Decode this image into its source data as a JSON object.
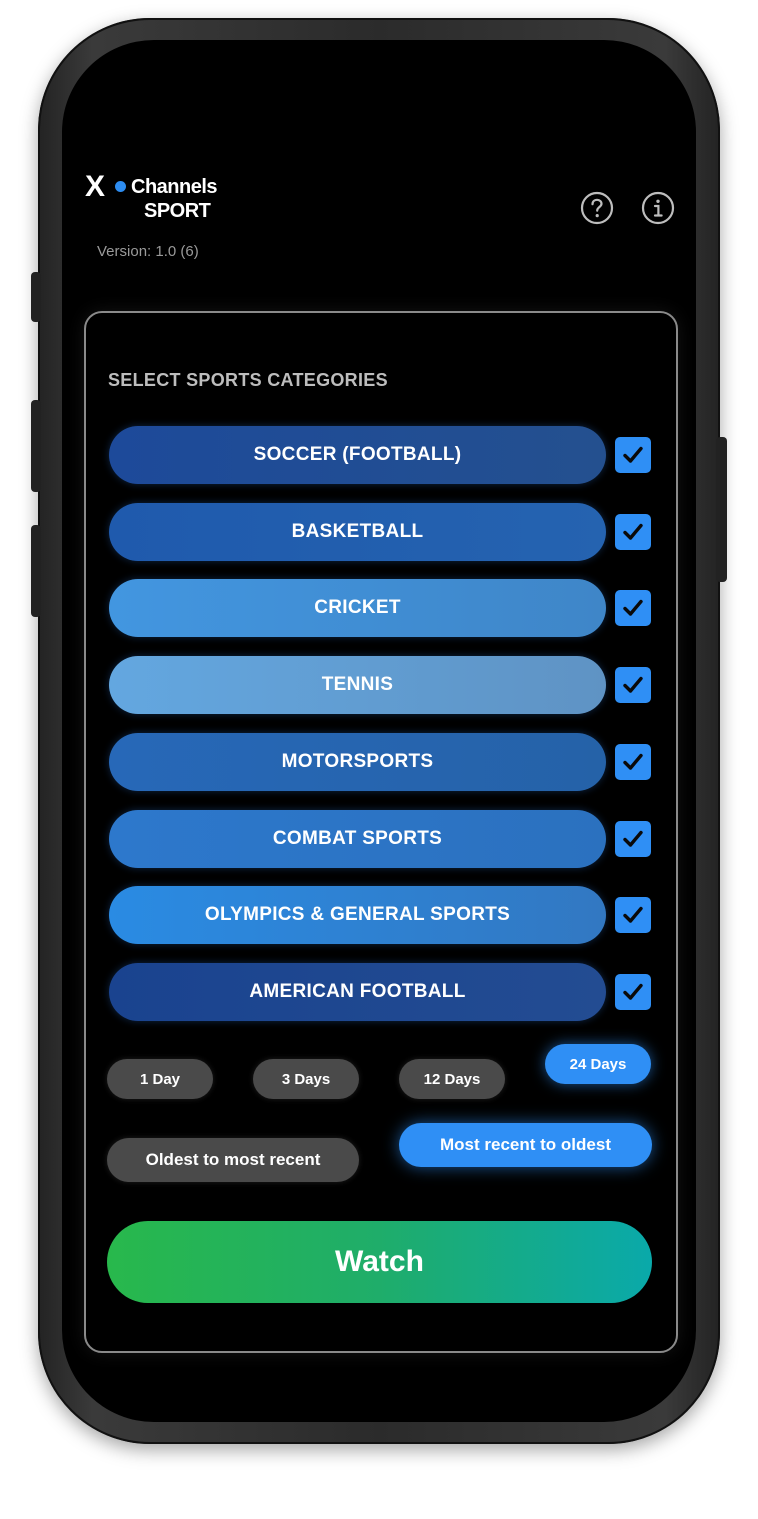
{
  "app": {
    "logo_x": "X",
    "logo_channels": "Channels",
    "logo_sport": "SPORT",
    "version": "Version: 1.0 (6)"
  },
  "header": {
    "help_icon": "question-circle-icon",
    "info_icon": "info-circle-icon"
  },
  "categories_title": "SELECT SPORTS CATEGORIES",
  "categories": [
    {
      "label": "SOCCER (FOOTBALL)",
      "checked": true,
      "color_start": "#1d4a9a",
      "color_end": "#24508f"
    },
    {
      "label": "BASKETBALL",
      "checked": true,
      "color_start": "#1f5aad",
      "color_end": "#2563b0"
    },
    {
      "label": "CRICKET",
      "checked": true,
      "color_start": "#4296e0",
      "color_end": "#3f86c8"
    },
    {
      "label": "TENNIS",
      "checked": true,
      "color_start": "#63a7e0",
      "color_end": "#5f93c4"
    },
    {
      "label": "MOTORSPORTS",
      "checked": true,
      "color_start": "#2768b8",
      "color_end": "#2562a8"
    },
    {
      "label": "COMBAT SPORTS",
      "checked": true,
      "color_start": "#2d78cc",
      "color_end": "#2b71bf"
    },
    {
      "label": "OLYMPICS & GENERAL SPORTS",
      "checked": true,
      "color_start": "#2a8be3",
      "color_end": "#3278c2"
    },
    {
      "label": "AMERICAN FOOTBALL",
      "checked": true,
      "color_start": "#1a438f",
      "color_end": "#234c92"
    }
  ],
  "time_range": {
    "options": [
      "1 Day",
      "3 Days",
      "12 Days",
      "24 Days"
    ],
    "selected": "24 Days"
  },
  "sort": {
    "options": [
      "Oldest to most recent",
      "Most recent to oldest"
    ],
    "selected": "Most recent to oldest"
  },
  "watch_label": "Watch",
  "colors": {
    "accent": "#2f8ff5",
    "watch_start": "#28b84c",
    "watch_end": "#0aa9aa",
    "chip_off": "#4a4a4a"
  }
}
